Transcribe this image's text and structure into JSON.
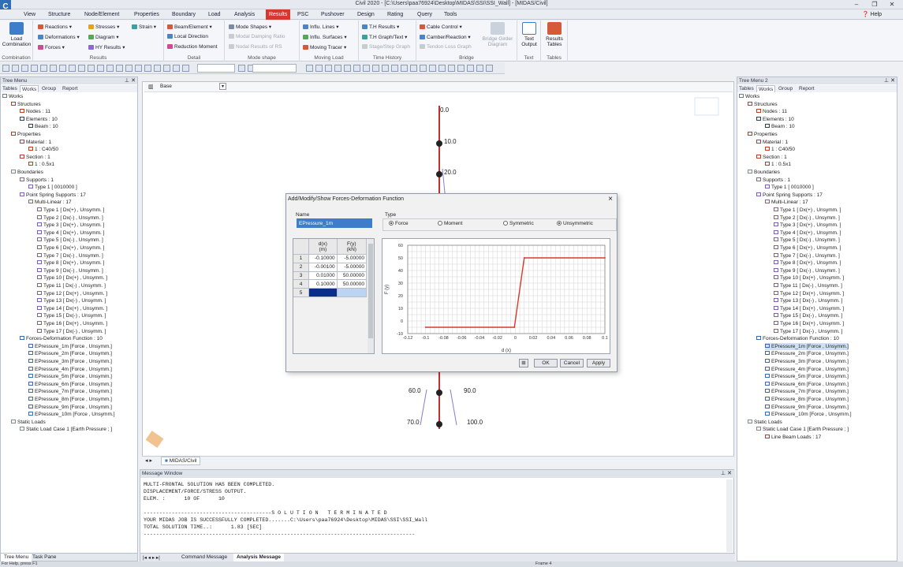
{
  "window": {
    "app_logo": "C",
    "title": "Civil 2020 - [C:\\Users\\paa76924\\Desktop\\MIDAS\\SSI\\SSI_Wall] - [MIDAS/Civil]",
    "help_label": "Help"
  },
  "menu_tabs": [
    "View",
    "Structure",
    "Node/Element",
    "Properties",
    "Boundary",
    "Load",
    "Analysis",
    "Results",
    "PSC",
    "Pushover",
    "Design",
    "Rating",
    "Query",
    "Tools"
  ],
  "active_menu_tab": "Results",
  "ribbon": {
    "combination": {
      "big_button": "Load\nCombination",
      "label": "Combination"
    },
    "results": {
      "items": [
        "Reactions",
        "Deformations",
        "Forces",
        "Stresses",
        "Diagram",
        "HY Results",
        "Strain"
      ],
      "label": "Results"
    },
    "detail": {
      "items": [
        "Beam/Element",
        "Local Direction",
        "Reduction Moment"
      ],
      "label": "Detail"
    },
    "mode_shape": {
      "items": [
        "Mode Shapes",
        "Modal Damping Ratio",
        "Nodal Results of RS"
      ],
      "label": "Mode shape"
    },
    "moving_load": {
      "items": [
        "Influ. Lines",
        "Influ. Surfaces",
        "Moving Tracer"
      ],
      "label": "Moving Load"
    },
    "time_history": {
      "items": [
        "T.H Results",
        "T.H Graph/Text",
        "Stage/Step Graph"
      ],
      "label": "Time History"
    },
    "bridge": {
      "items": [
        "Cable Control",
        "Camber/Reaction",
        "Tendon Loss Graph"
      ],
      "big_button": "Bridge Girder\nDiagram",
      "label": "Bridge"
    },
    "text": {
      "big_button": "Text\nOutput",
      "label": "Text"
    },
    "tables": {
      "big_button": "Results\nTables",
      "label": "Tables"
    }
  },
  "left_panel": {
    "header": "Tree Menu",
    "tabs": [
      "Tables",
      "Works",
      "Group",
      "Report"
    ],
    "active_tab": "Works",
    "tree": [
      {
        "t": "Works",
        "d": 0,
        "c": "#6b7b8c"
      },
      {
        "t": "Structures",
        "d": 1,
        "c": "#c0392b"
      },
      {
        "t": "Nodes : 11",
        "d": 2,
        "c": "#c0392b"
      },
      {
        "t": "Elements : 10",
        "d": 2,
        "c": "#2c3e50"
      },
      {
        "t": "Beam : 10",
        "d": 3,
        "c": "#2c3e50"
      },
      {
        "t": "Properties",
        "d": 1,
        "c": "#c0392b"
      },
      {
        "t": "Material : 1",
        "d": 2,
        "c": "#c0392b"
      },
      {
        "t": "1 : C40/50",
        "d": 3,
        "c": "#c0392b"
      },
      {
        "t": "Section : 1",
        "d": 2,
        "c": "#c0392b"
      },
      {
        "t": "1 : 0.5x1",
        "d": 3,
        "c": "#c0392b"
      },
      {
        "t": "Boundaries",
        "d": 1,
        "c": "#7f8c8d"
      },
      {
        "t": "Supports : 1",
        "d": 2,
        "c": "#7d5fb3"
      },
      {
        "t": "Type 1 [ 0010000 ]",
        "d": 3,
        "c": "#7d5fb3"
      },
      {
        "t": "Point Spring Supports : 17",
        "d": 2,
        "c": "#7d5fb3"
      },
      {
        "t": "Multi-Linear : 17",
        "d": 3,
        "c": "#7d5fb3"
      },
      {
        "t": "Type 1 [ Dx(+) , Unsymm. ]",
        "d": 4,
        "c": "#7d5fb3"
      },
      {
        "t": "Type 2 [ Dx(-) , Unsymm. ]",
        "d": 4,
        "c": "#7d5fb3"
      },
      {
        "t": "Type 3 [ Dx(+) , Unsymm. ]",
        "d": 4,
        "c": "#7d5fb3"
      },
      {
        "t": "Type 4 [ Dx(+) , Unsymm. ]",
        "d": 4,
        "c": "#7d5fb3"
      },
      {
        "t": "Type 5 [ Dx(-) , Unsymm. ]",
        "d": 4,
        "c": "#7d5fb3"
      },
      {
        "t": "Type 6 [ Dx(+) , Unsymm. ]",
        "d": 4,
        "c": "#7d5fb3"
      },
      {
        "t": "Type 7 [ Dx(-) , Unsymm. ]",
        "d": 4,
        "c": "#7d5fb3"
      },
      {
        "t": "Type 8 [ Dx(+) , Unsymm. ]",
        "d": 4,
        "c": "#7d5fb3"
      },
      {
        "t": "Type 9 [ Dx(-) , Unsymm. ]",
        "d": 4,
        "c": "#7d5fb3"
      },
      {
        "t": "Type 10 [ Dx(+) , Unsymm. ]",
        "d": 4,
        "c": "#7d5fb3"
      },
      {
        "t": "Type 11 [ Dx(-) , Unsymm. ]",
        "d": 4,
        "c": "#7d5fb3"
      },
      {
        "t": "Type 12 [ Dx(+) , Unsymm. ]",
        "d": 4,
        "c": "#7d5fb3"
      },
      {
        "t": "Type 13 [ Dx(-) , Unsymm. ]",
        "d": 4,
        "c": "#7d5fb3"
      },
      {
        "t": "Type 14 [ Dx(+) , Unsymm. ]",
        "d": 4,
        "c": "#7d5fb3"
      },
      {
        "t": "Type 15 [ Dx(-) , Unsymm. ]",
        "d": 4,
        "c": "#7d5fb3"
      },
      {
        "t": "Type 16 [ Dx(+) , Unsymm. ]",
        "d": 4,
        "c": "#7d5fb3"
      },
      {
        "t": "Type 17 [ Dx(-) , Unsymm. ]",
        "d": 4,
        "c": "#7d5fb3"
      },
      {
        "t": "Forces-Deformation Function : 10",
        "d": 2,
        "c": "#3f66b0"
      },
      {
        "t": "EPressure_1m [Force , Unsymm.]",
        "d": 3,
        "c": "#3f66b0"
      },
      {
        "t": "EPressure_2m [Force , Unsymm.]",
        "d": 3,
        "c": "#3f66b0"
      },
      {
        "t": "EPressure_3m [Force , Unsymm.]",
        "d": 3,
        "c": "#3f66b0"
      },
      {
        "t": "EPressure_4m [Force , Unsymm.]",
        "d": 3,
        "c": "#3f66b0"
      },
      {
        "t": "EPressure_5m [Force , Unsymm.]",
        "d": 3,
        "c": "#3f66b0"
      },
      {
        "t": "EPressure_6m [Force , Unsymm.]",
        "d": 3,
        "c": "#3f66b0"
      },
      {
        "t": "EPressure_7m [Force , Unsymm.]",
        "d": 3,
        "c": "#3f66b0"
      },
      {
        "t": "EPressure_8m [Force , Unsymm.]",
        "d": 3,
        "c": "#3f66b0"
      },
      {
        "t": "EPressure_9m [Force , Unsymm.]",
        "d": 3,
        "c": "#3f66b0"
      },
      {
        "t": "EPressure_10m [Force , Unsymm.]",
        "d": 3,
        "c": "#3f66b0"
      },
      {
        "t": "Static Loads",
        "d": 1,
        "c": "#7f8c8d"
      },
      {
        "t": "Static Load Case 1 [Earth Pressure ; ]",
        "d": 2,
        "c": "#7f8c8d"
      }
    ],
    "bottom_tabs": [
      "Tree Menu",
      "Task Pane"
    ]
  },
  "right_panel": {
    "header": "Tree Menu 2",
    "tabs": [
      "Tables",
      "Works",
      "Group",
      "Report"
    ],
    "active_tab": "Works",
    "tree": [
      {
        "t": "Works",
        "d": 0,
        "c": "#6b7b8c"
      },
      {
        "t": "Structures",
        "d": 1,
        "c": "#c0392b"
      },
      {
        "t": "Nodes : 11",
        "d": 2,
        "c": "#c0392b"
      },
      {
        "t": "Elements : 10",
        "d": 2,
        "c": "#2c3e50"
      },
      {
        "t": "Beam : 10",
        "d": 3,
        "c": "#2c3e50"
      },
      {
        "t": "Properties",
        "d": 1,
        "c": "#c0392b"
      },
      {
        "t": "Material : 1",
        "d": 2,
        "c": "#c0392b"
      },
      {
        "t": "1 : C40/50",
        "d": 3,
        "c": "#c0392b"
      },
      {
        "t": "Section : 1",
        "d": 2,
        "c": "#c0392b"
      },
      {
        "t": "1 : 0.5x1",
        "d": 3,
        "c": "#c0392b"
      },
      {
        "t": "Boundaries",
        "d": 1,
        "c": "#7f8c8d"
      },
      {
        "t": "Supports : 1",
        "d": 2,
        "c": "#7d5fb3"
      },
      {
        "t": "Type 1 [ 0010000 ]",
        "d": 3,
        "c": "#7d5fb3"
      },
      {
        "t": "Point Spring Supports : 17",
        "d": 2,
        "c": "#7d5fb3"
      },
      {
        "t": "Multi-Linear : 17",
        "d": 3,
        "c": "#7d5fb3"
      },
      {
        "t": "Type 1 [ Dx(+) , Unsymm. ]",
        "d": 4,
        "c": "#7d5fb3"
      },
      {
        "t": "Type 2 [ Dx(-) , Unsymm. ]",
        "d": 4,
        "c": "#7d5fb3"
      },
      {
        "t": "Type 3 [ Dx(+) , Unsymm. ]",
        "d": 4,
        "c": "#7d5fb3"
      },
      {
        "t": "Type 4 [ Dx(+) , Unsymm. ]",
        "d": 4,
        "c": "#7d5fb3"
      },
      {
        "t": "Type 5 [ Dx(-) , Unsymm. ]",
        "d": 4,
        "c": "#7d5fb3"
      },
      {
        "t": "Type 6 [ Dx(+) , Unsymm. ]",
        "d": 4,
        "c": "#7d5fb3"
      },
      {
        "t": "Type 7 [ Dx(-) , Unsymm. ]",
        "d": 4,
        "c": "#7d5fb3"
      },
      {
        "t": "Type 8 [ Dx(+) , Unsymm. ]",
        "d": 4,
        "c": "#7d5fb3"
      },
      {
        "t": "Type 9 [ Dx(-) , Unsymm. ]",
        "d": 4,
        "c": "#7d5fb3"
      },
      {
        "t": "Type 10 [ Dx(+) , Unsymm. ]",
        "d": 4,
        "c": "#7d5fb3"
      },
      {
        "t": "Type 11 [ Dx(-) , Unsymm. ]",
        "d": 4,
        "c": "#7d5fb3"
      },
      {
        "t": "Type 12 [ Dx(+) , Unsymm. ]",
        "d": 4,
        "c": "#7d5fb3"
      },
      {
        "t": "Type 13 [ Dx(-) , Unsymm. ]",
        "d": 4,
        "c": "#7d5fb3"
      },
      {
        "t": "Type 14 [ Dx(+) , Unsymm. ]",
        "d": 4,
        "c": "#7d5fb3"
      },
      {
        "t": "Type 15 [ Dx(-) , Unsymm. ]",
        "d": 4,
        "c": "#7d5fb3"
      },
      {
        "t": "Type 16 [ Dx(+) , Unsymm. ]",
        "d": 4,
        "c": "#7d5fb3"
      },
      {
        "t": "Type 17 [ Dx(-) , Unsymm. ]",
        "d": 4,
        "c": "#7d5fb3"
      },
      {
        "t": "Forces-Deformation Function : 10",
        "d": 2,
        "c": "#3f66b0"
      },
      {
        "t": "EPressure_1m [Force , Unsymm.]",
        "d": 3,
        "c": "#3f66b0",
        "sel": true
      },
      {
        "t": "EPressure_2m [Force , Unsymm.]",
        "d": 3,
        "c": "#3f66b0"
      },
      {
        "t": "EPressure_3m [Force , Unsymm.]",
        "d": 3,
        "c": "#3f66b0"
      },
      {
        "t": "EPressure_4m [Force , Unsymm.]",
        "d": 3,
        "c": "#3f66b0"
      },
      {
        "t": "EPressure_5m [Force , Unsymm.]",
        "d": 3,
        "c": "#3f66b0"
      },
      {
        "t": "EPressure_6m [Force , Unsymm.]",
        "d": 3,
        "c": "#3f66b0"
      },
      {
        "t": "EPressure_7m [Force , Unsymm.]",
        "d": 3,
        "c": "#3f66b0"
      },
      {
        "t": "EPressure_8m [Force , Unsymm.]",
        "d": 3,
        "c": "#3f66b0"
      },
      {
        "t": "EPressure_9m [Force , Unsymm.]",
        "d": 3,
        "c": "#3f66b0"
      },
      {
        "t": "EPressure_10m [Force , Unsymm.]",
        "d": 3,
        "c": "#3f66b0"
      },
      {
        "t": "Static Loads",
        "d": 1,
        "c": "#7f8c8d"
      },
      {
        "t": "Static Load Case 1 [Earth Pressure ; ]",
        "d": 2,
        "c": "#7f8c8d"
      },
      {
        "t": "Line Beam Loads : 17",
        "d": 3,
        "c": "#c0392b"
      }
    ]
  },
  "view": {
    "base_label": "Base",
    "doc_tab": "MIDAS/Civil",
    "depth_labels_right": [
      "0.0",
      "10.0",
      "20.0",
      "90.0",
      "100.0"
    ],
    "depth_labels_left": [
      "60.0",
      "70.0"
    ]
  },
  "dialog": {
    "title": "Add/Modify/Show Forces-Deformation Function",
    "name_label": "Name",
    "name_value": "EPressure_1m",
    "type_label": "Type",
    "type_options": [
      "Force",
      "Moment"
    ],
    "type_selected": "Force",
    "symmetry_options": [
      "Symmetric",
      "Unsymmetric"
    ],
    "symmetry_selected": "Unsymmetric",
    "table": {
      "headers": [
        [
          "d(x)",
          "(m)"
        ],
        [
          "F(y)",
          "(kN)"
        ]
      ],
      "rows": [
        {
          "n": "1",
          "dx": "-0.10000",
          "fy": "-5.00000"
        },
        {
          "n": "2",
          "dx": "-0.00100",
          "fy": "-5.00000"
        },
        {
          "n": "3",
          "dx": "0.01000",
          "fy": "50.00000"
        },
        {
          "n": "4",
          "dx": "0.10000",
          "fy": "50.00000"
        },
        {
          "n": "5",
          "dx": "",
          "fy": ""
        }
      ]
    },
    "buttons": {
      "ok": "OK",
      "cancel": "Cancel",
      "apply": "Apply"
    },
    "close": "×"
  },
  "chart_data": {
    "type": "line",
    "xlabel": "d (x)",
    "ylabel": "F (y)",
    "xlim": [
      -0.12,
      0.1
    ],
    "ylim": [
      -10,
      60
    ],
    "x_ticks": [
      "-0.12",
      "-0.1",
      "-0.08",
      "-0.06",
      "-0.04",
      "-0.02",
      "0",
      "0.02",
      "0.04",
      "0.06",
      "0.08",
      "0.1"
    ],
    "y_ticks": [
      "60",
      "50",
      "40",
      "30",
      "20",
      "10",
      "0",
      "-10"
    ],
    "grid": true,
    "series": [
      {
        "x": [
          -0.1,
          -0.001,
          0.01,
          0.1
        ],
        "y": [
          -5,
          -5,
          50,
          50
        ],
        "color": "#d63a2a"
      }
    ]
  },
  "message_window": {
    "header": "Message Window",
    "lines": [
      "MULTI-FRONTAL SOLUTION HAS BEEN COMPLETED.",
      "DISPLACEMENT/FORCE/STRESS OUTPUT.",
      "ELEM. :      10 OF      10",
      "",
      "-----------------------------------------S O L U T I O N   T E R M I N A T E D",
      "YOUR MIDAS JOB IS SUCCESSFULLY COMPLETED.......C:\\Users\\paa76924\\Desktop\\MIDAS\\SSI\\SSI_Wall",
      "TOTAL SOLUTION TIME..:      1.83 [SEC]",
      "---------------------------------------------------------------------------------------"
    ],
    "tabs": [
      "Command Message",
      "Analysis Message"
    ],
    "active_tab": "Analysis Message"
  },
  "status": {
    "left": "For Help, press F1",
    "frame": "Frame 4"
  }
}
